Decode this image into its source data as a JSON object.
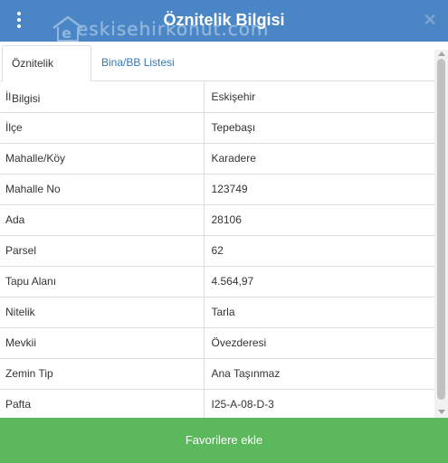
{
  "header": {
    "title": "Öznitelik Bilgisi",
    "watermark": "eskisehirkonut.com",
    "menu_icon": "kebab-menu-icon",
    "close_icon": "close-icon",
    "close_glyph": "✕",
    "color": "#4a86c6"
  },
  "tabs": [
    {
      "label": "Öznitelik Bilgisi",
      "active": true
    },
    {
      "label": "Bina/BB Listesi",
      "active": false
    }
  ],
  "attributes": [
    {
      "key": "İl",
      "value": "Eskişehir"
    },
    {
      "key": "İlçe",
      "value": "Tepebaşı"
    },
    {
      "key": "Mahalle/Köy",
      "value": "Karadere"
    },
    {
      "key": "Mahalle No",
      "value": "123749"
    },
    {
      "key": "Ada",
      "value": "28106"
    },
    {
      "key": "Parsel",
      "value": "62"
    },
    {
      "key": "Tapu Alanı",
      "value": "4.564,97"
    },
    {
      "key": "Nitelik",
      "value": "Tarla"
    },
    {
      "key": "Mevkii",
      "value": "Övezderesi"
    },
    {
      "key": "Zemin Tip",
      "value": "Ana Taşınmaz"
    },
    {
      "key": "Pafta",
      "value": "I25-A-08-D-3"
    }
  ],
  "footer": {
    "button_label": "Favorilere ekle",
    "color": "#5cb85c"
  }
}
